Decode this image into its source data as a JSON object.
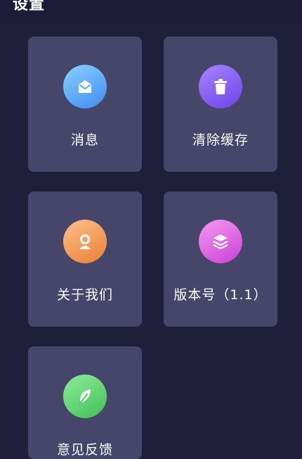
{
  "header": {
    "title": "设置"
  },
  "tiles": [
    {
      "label": "消息",
      "icon": "envelope-icon",
      "color": "#3d8bf2"
    },
    {
      "label": "清除缓存",
      "icon": "trash-icon",
      "color": "#6c43e8"
    },
    {
      "label": "关于我们",
      "icon": "person-icon",
      "color": "#ea7f35"
    },
    {
      "label": "版本号（1.1）",
      "icon": "layers-icon",
      "color": "#c93ed8"
    },
    {
      "label": "意见反馈",
      "icon": "leaf-icon",
      "color": "#3fbf55"
    }
  ],
  "colors": {
    "background": "#1f1f3a",
    "tile": "#46466a",
    "text": "#ffffff"
  }
}
